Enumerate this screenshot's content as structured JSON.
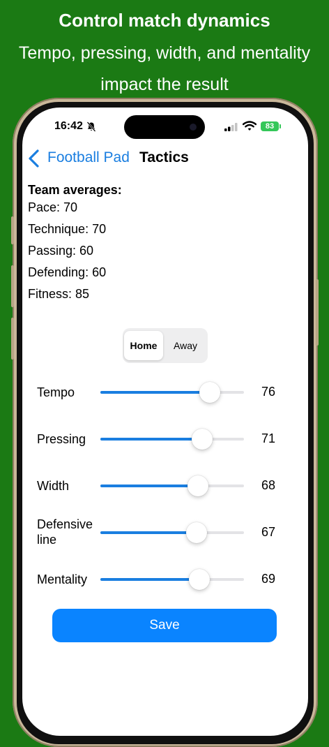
{
  "promo": {
    "title": "Control match dynamics",
    "subtitle_line1": "Tempo, pressing, width, and mentality",
    "subtitle_line2": "impact the result"
  },
  "status_bar": {
    "time": "16:42",
    "battery": "83"
  },
  "nav": {
    "back_label": "Football Pad",
    "title": "Tactics"
  },
  "team_averages": {
    "title": "Team averages:",
    "items": [
      "Pace: 70",
      "Technique: 70",
      "Passing: 60",
      "Defending: 60",
      "Fitness: 85"
    ]
  },
  "segment": {
    "options": [
      "Home",
      "Away"
    ],
    "selected": "Home"
  },
  "sliders": [
    {
      "label_line1": "Tempo",
      "label_line2": "",
      "value": 76
    },
    {
      "label_line1": "Pressing",
      "label_line2": "",
      "value": 71
    },
    {
      "label_line1": "Width",
      "label_line2": "",
      "value": 68
    },
    {
      "label_line1": "Defensive",
      "label_line2": "line",
      "value": 67
    },
    {
      "label_line1": "Mentality",
      "label_line2": "",
      "value": 69
    }
  ],
  "save_button": {
    "label": "Save"
  },
  "colors": {
    "background": "#1b7a14",
    "accent": "#1a7ee0",
    "button": "#0a84ff",
    "battery": "#34c759"
  }
}
